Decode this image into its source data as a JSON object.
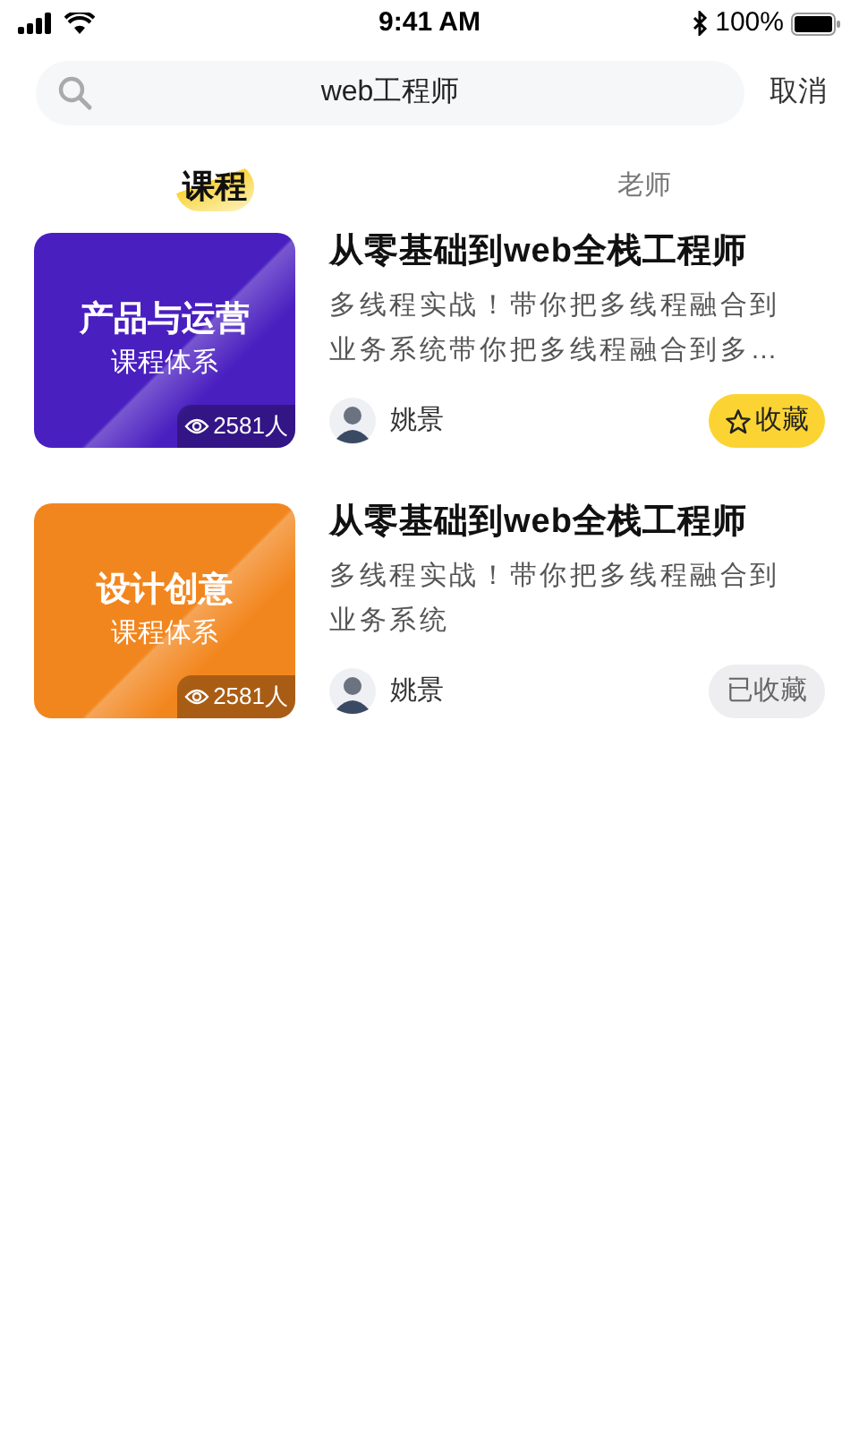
{
  "status_bar": {
    "time": "9:41 AM",
    "battery": "100%"
  },
  "search": {
    "value": "web工程师",
    "cancel": "取消"
  },
  "tabs": [
    {
      "label": "课程",
      "selected": true
    },
    {
      "label": "老师",
      "selected": false
    }
  ],
  "courses": [
    {
      "cover": {
        "title": "产品与运营",
        "subtitle": "课程体系",
        "views": "2581人",
        "color": "#4a1fc0"
      },
      "title": "从零基础到web全栈工程师",
      "description_lines": [
        "多线程实战！带你把多线程融合到",
        "业务系统带你把多线程融合到多…"
      ],
      "teacher": "姚景",
      "collect_label": "收藏",
      "collected": false
    },
    {
      "cover": {
        "title": "设计创意",
        "subtitle": "课程体系",
        "views": "2581人",
        "color": "#f2861e"
      },
      "title": "从零基础到web全栈工程师",
      "description_lines": [
        "多线程实战！带你把多线程融合到",
        "业务系统"
      ],
      "teacher": "姚景",
      "collect_label": "已收藏",
      "collected": true
    }
  ]
}
